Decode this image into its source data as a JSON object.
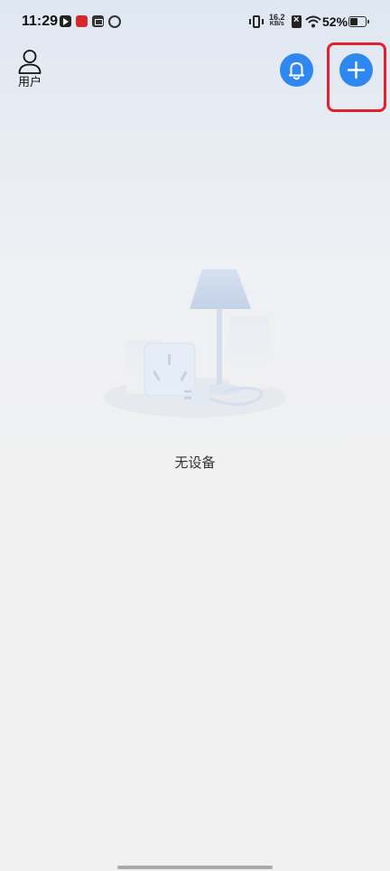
{
  "status_bar": {
    "time": "11:29",
    "net_speed_value": "16.2",
    "net_speed_unit": "KB/s",
    "battery_percent": "52%",
    "battery_level": 0.52
  },
  "header": {
    "user_label": "用户",
    "icons": [
      "user-icon",
      "bell-icon",
      "plus-icon"
    ]
  },
  "empty_state": {
    "message": "无设备",
    "illustration": "lamp-and-socket-illustration"
  },
  "colors": {
    "accent": "#2f88f0",
    "highlight": "#e3202d",
    "background": "#f1f1f1"
  }
}
